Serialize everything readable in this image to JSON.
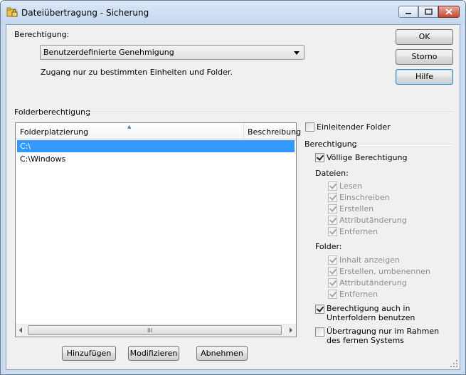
{
  "window": {
    "title": "Dateiübertragung - Sicherung"
  },
  "permission": {
    "label": "Berechtigung:",
    "selected": "Benutzerdefinierte Genehmigung",
    "description": "Zugang nur zu bestimmten Einheiten und Folder."
  },
  "dialog_buttons": {
    "ok": "OK",
    "cancel": "Storno",
    "help": "Hilfe"
  },
  "folder_section": {
    "title": "Folderberechtigung",
    "columns": [
      "Folderplatzierung",
      "Beschreibung"
    ],
    "rows": [
      {
        "path": "C:\\",
        "selected": true
      },
      {
        "path": "C:\\Windows",
        "selected": false
      }
    ],
    "scroll_grip": "III"
  },
  "list_buttons": {
    "add": "Hinzufügen",
    "modify": "Modifizieren",
    "remove": "Abnehmen"
  },
  "options": {
    "root_folder": {
      "label": "Einleitender Folder",
      "checked": false
    },
    "permission_title": "Berechtigung",
    "full_access": {
      "label": "Völlige Berechtigung",
      "checked": true
    },
    "files_label": "Dateien:",
    "files": [
      {
        "label": "Lesen",
        "checked": true
      },
      {
        "label": "Einschreiben",
        "checked": true
      },
      {
        "label": "Erstellen",
        "checked": true
      },
      {
        "label": "Attributänderung",
        "checked": true
      },
      {
        "label": "Entfernen",
        "checked": true
      }
    ],
    "folders_label": "Folder:",
    "folders": [
      {
        "label": "Inhalt anzeigen",
        "checked": true
      },
      {
        "label": "Erstellen, umbenennen",
        "checked": true
      },
      {
        "label": "Attributänderung",
        "checked": true
      },
      {
        "label": "Entfernen",
        "checked": true
      }
    ],
    "subfolders": {
      "label": "Berechtigung auch in Unterfoldern benutzen",
      "checked": true
    },
    "remote_only": {
      "label": "Übertragung nur im Rahmen des fernen Systems",
      "checked": false
    }
  },
  "colors": {
    "selection": "#3399ff",
    "frame": "#c9dcf2",
    "close_button": "#c64936"
  }
}
